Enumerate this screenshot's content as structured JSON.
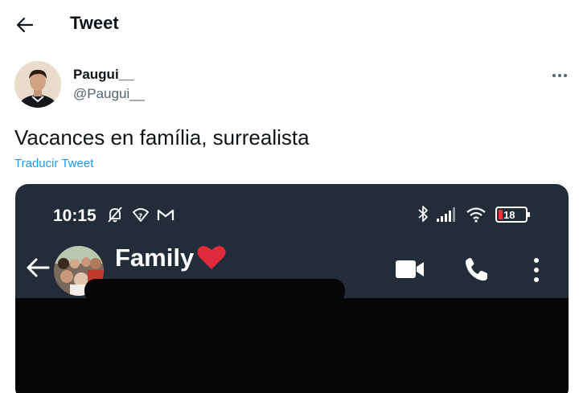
{
  "header": {
    "title": "Tweet",
    "back_icon": "arrow-left-icon"
  },
  "author": {
    "display_name": "Paugui__",
    "handle": "@Paugui__",
    "more_icon": "more-horizontal-icon"
  },
  "tweet": {
    "text": "Vacances en família, surrealista",
    "translate_label": "Traducir Tweet"
  },
  "media": {
    "status_bar": {
      "time": "10:15",
      "left_icons": [
        "bell-off-icon",
        "wifi-question-icon",
        "gmail-icon"
      ],
      "right_icons": [
        "bluetooth-icon",
        "signal-icon",
        "wifi-icon",
        "battery-icon"
      ],
      "battery": "18",
      "battery_color": "#e53935"
    },
    "chat_header": {
      "name": "Family",
      "emoji": "❤️",
      "back_icon": "arrow-left-icon",
      "video_icon": "video-camera-icon",
      "call_icon": "phone-icon",
      "menu_icon": "kebab-menu-icon"
    }
  },
  "colors": {
    "accent": "#1d9bf0",
    "text": "#0f1419",
    "secondary": "#536471",
    "chat_bg": "#232d3a"
  }
}
